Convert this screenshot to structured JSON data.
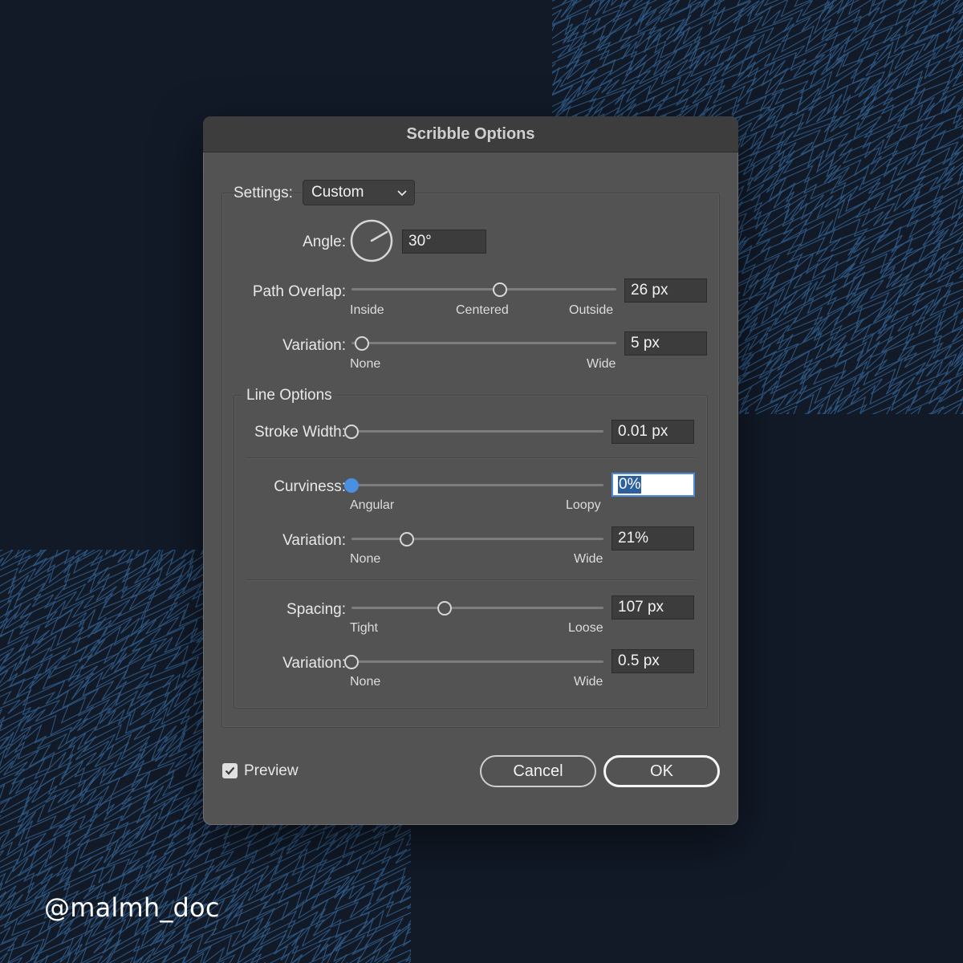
{
  "dialog": {
    "title": "Scribble Options"
  },
  "settings": {
    "label": "Settings:",
    "selected": "Custom"
  },
  "angle": {
    "label": "Angle:",
    "value": "30°",
    "degrees": 30
  },
  "path_overlap": {
    "label": "Path Overlap:",
    "value": "26 px",
    "position": 0.56,
    "min_label": "Inside",
    "mid_label": "Centered",
    "max_label": "Outside"
  },
  "variation_1": {
    "label": "Variation:",
    "value": "5 px",
    "position": 0.04,
    "min_label": "None",
    "max_label": "Wide"
  },
  "line_options": {
    "title": "Line Options",
    "stroke_width": {
      "label": "Stroke Width:",
      "value": "0.01 px",
      "position": 0.0
    },
    "curviness": {
      "label": "Curviness:",
      "value": "0%",
      "position": 0.0,
      "min_label": "Angular",
      "max_label": "Loopy"
    },
    "curviness_variation": {
      "label": "Variation:",
      "value": "21%",
      "position": 0.22,
      "min_label": "None",
      "max_label": "Wide"
    },
    "spacing": {
      "label": "Spacing:",
      "value": "107 px",
      "position": 0.37,
      "min_label": "Tight",
      "max_label": "Loose"
    },
    "spacing_variation": {
      "label": "Variation:",
      "value": "0.5 px",
      "position": 0.0,
      "min_label": "None",
      "max_label": "Wide"
    }
  },
  "preview": {
    "label": "Preview",
    "checked": true
  },
  "buttons": {
    "cancel": "Cancel",
    "ok": "OK"
  },
  "watermark": "@malmh_doc",
  "colors": {
    "background": "#121a28",
    "pattern": "#2f5a86",
    "accent": "#4a90e2",
    "dialog": "#535353"
  },
  "icons": {
    "dropdown": "chevron-down-icon",
    "angle": "angle-dial-icon",
    "preview": "checkmark-icon"
  }
}
